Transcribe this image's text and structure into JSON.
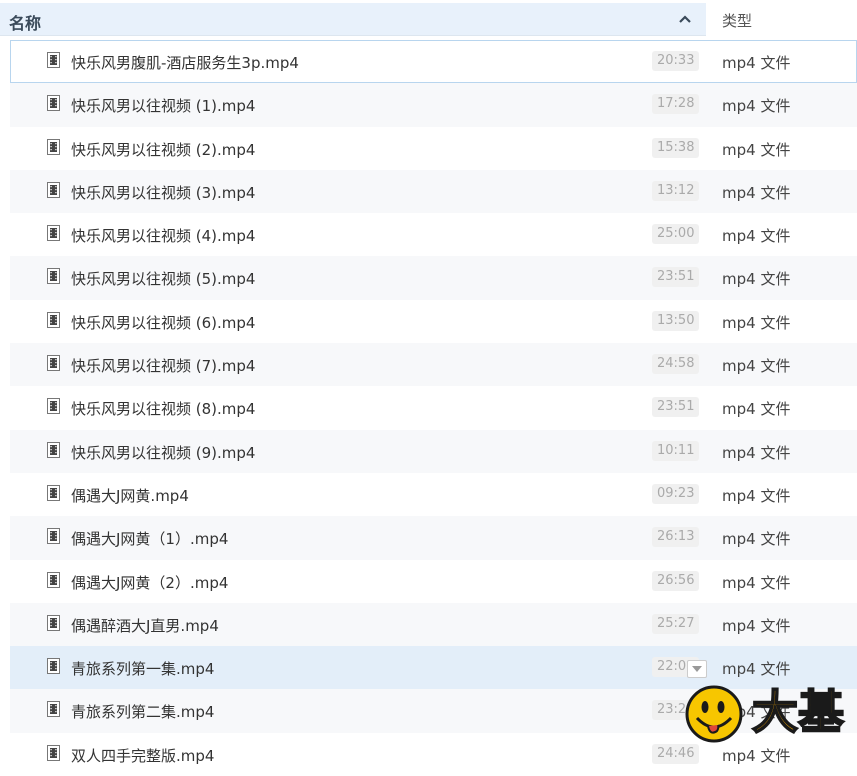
{
  "header": {
    "name_label": "名称",
    "type_label": "类型"
  },
  "files": [
    {
      "name": "快乐风男腹肌-酒店服务生3p.mp4",
      "duration": "20:33",
      "type": "mp4 文件"
    },
    {
      "name": "快乐风男以往视频 (1).mp4",
      "duration": "17:28",
      "type": "mp4 文件"
    },
    {
      "name": "快乐风男以往视频 (2).mp4",
      "duration": "15:38",
      "type": "mp4 文件"
    },
    {
      "name": "快乐风男以往视频 (3).mp4",
      "duration": "13:12",
      "type": "mp4 文件"
    },
    {
      "name": "快乐风男以往视频 (4).mp4",
      "duration": "25:00",
      "type": "mp4 文件"
    },
    {
      "name": "快乐风男以往视频 (5).mp4",
      "duration": "23:51",
      "type": "mp4 文件"
    },
    {
      "name": "快乐风男以往视频 (6).mp4",
      "duration": "13:50",
      "type": "mp4 文件"
    },
    {
      "name": "快乐风男以往视频 (7).mp4",
      "duration": "24:58",
      "type": "mp4 文件"
    },
    {
      "name": "快乐风男以往视频 (8).mp4",
      "duration": "23:51",
      "type": "mp4 文件"
    },
    {
      "name": "快乐风男以往视频 (9).mp4",
      "duration": "10:11",
      "type": "mp4 文件"
    },
    {
      "name": "偶遇大J网黄.mp4",
      "duration": "09:23",
      "type": "mp4 文件"
    },
    {
      "name": "偶遇大J网黄（1）.mp4",
      "duration": "26:13",
      "type": "mp4 文件"
    },
    {
      "name": "偶遇大J网黄（2）.mp4",
      "duration": "26:56",
      "type": "mp4 文件"
    },
    {
      "name": "偶遇醉酒大J直男.mp4",
      "duration": "25:27",
      "type": "mp4 文件"
    },
    {
      "name": "青旅系列第一集.mp4",
      "duration": "22:00",
      "type": "mp4 文件"
    },
    {
      "name": "青旅系列第二集.mp4",
      "duration": "23:2",
      "type": "mp4 文件"
    },
    {
      "name": "双人四手完整版.mp4",
      "duration": "24:46",
      "type": "mp4 文件"
    }
  ],
  "watermark": {
    "text": "大基"
  },
  "colors": {
    "header_bg": "#e8f1fb",
    "selected_row": "#e3eef9",
    "watermark": "#f5a800"
  }
}
